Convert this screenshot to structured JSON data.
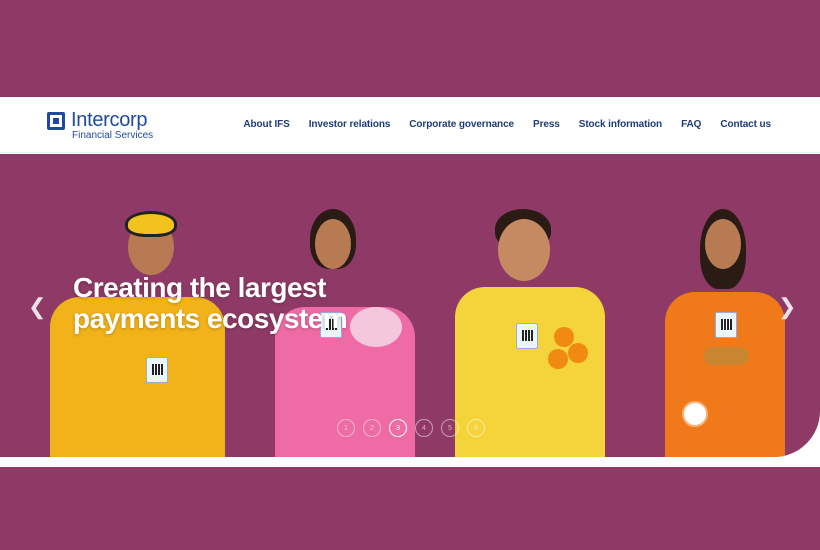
{
  "header": {
    "brand_name": "Intercorp",
    "brand_sub": "Financial Services",
    "nav": [
      "About IFS",
      "Investor relations",
      "Corporate governance",
      "Press",
      "Stock information",
      "FAQ",
      "Contact us"
    ]
  },
  "hero": {
    "headline_line1": "Creating the largest",
    "headline_line2": "payments ecosystem",
    "prev_icon": "chevron-left-icon",
    "next_icon": "chevron-right-icon",
    "slides": [
      "1",
      "2",
      "3",
      "4",
      "5",
      "6"
    ],
    "active_slide": "3"
  },
  "colors": {
    "background": "#8f3a66",
    "brand": "#1f4b9c",
    "nav_text": "#1f3c78",
    "header_bg": "#ffffff"
  }
}
